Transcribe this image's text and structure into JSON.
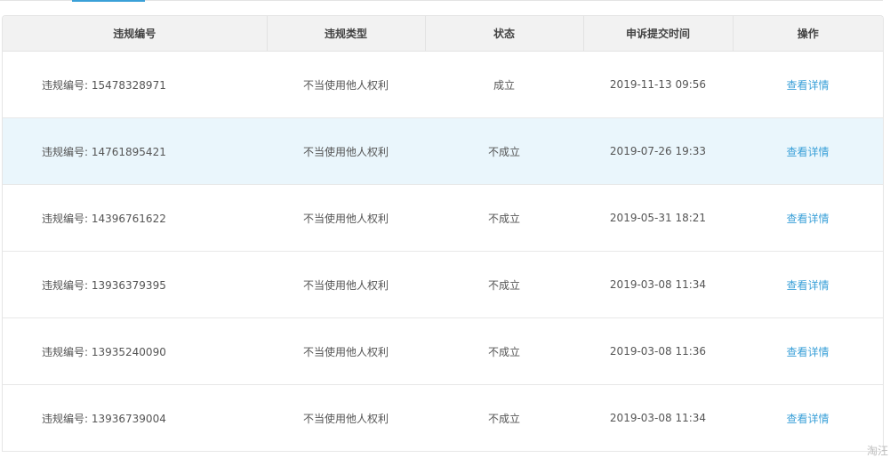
{
  "table": {
    "headers": [
      "违规编号",
      "违规类型",
      "状态",
      "申诉提交时间",
      "操作"
    ],
    "rows": [
      {
        "id": "违规编号: 15478328971",
        "type": "不当使用他人权利",
        "status": "成立",
        "time": "2019-11-13 09:56",
        "action": "查看详情"
      },
      {
        "id": "违规编号: 14761895421",
        "type": "不当使用他人权利",
        "status": "不成立",
        "time": "2019-07-26 19:33",
        "action": "查看详情"
      },
      {
        "id": "违规编号: 14396761622",
        "type": "不当使用他人权利",
        "status": "不成立",
        "time": "2019-05-31 18:21",
        "action": "查看详情"
      },
      {
        "id": "违规编号: 13936379395",
        "type": "不当使用他人权利",
        "status": "不成立",
        "time": "2019-03-08 11:34",
        "action": "查看详情"
      },
      {
        "id": "违规编号: 13935240090",
        "type": "不当使用他人权利",
        "status": "不成立",
        "time": "2019-03-08 11:36",
        "action": "查看详情"
      },
      {
        "id": "违规编号: 13936739004",
        "type": "不当使用他人权利",
        "status": "不成立",
        "time": "2019-03-08 11:34",
        "action": "查看详情"
      }
    ]
  },
  "watermark": "淘汪",
  "colors": {
    "link": "#3aa0d8",
    "highlight_row": "#eaf6fc",
    "header_bg": "#f2f2f2"
  }
}
